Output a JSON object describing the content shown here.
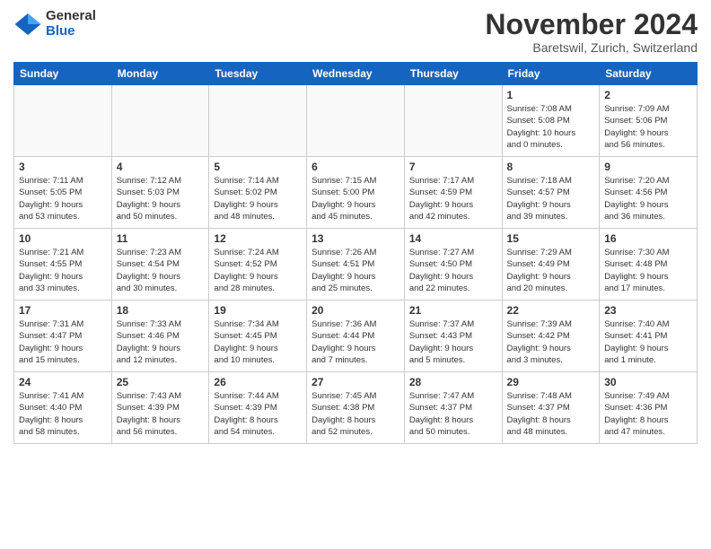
{
  "header": {
    "logo": {
      "general": "General",
      "blue": "Blue"
    },
    "title": "November 2024",
    "location": "Baretswil, Zurich, Switzerland"
  },
  "weekdays": [
    "Sunday",
    "Monday",
    "Tuesday",
    "Wednesday",
    "Thursday",
    "Friday",
    "Saturday"
  ],
  "weeks": [
    [
      {
        "day": "",
        "info": ""
      },
      {
        "day": "",
        "info": ""
      },
      {
        "day": "",
        "info": ""
      },
      {
        "day": "",
        "info": ""
      },
      {
        "day": "",
        "info": ""
      },
      {
        "day": "1",
        "info": "Sunrise: 7:08 AM\nSunset: 5:08 PM\nDaylight: 10 hours\nand 0 minutes."
      },
      {
        "day": "2",
        "info": "Sunrise: 7:09 AM\nSunset: 5:06 PM\nDaylight: 9 hours\nand 56 minutes."
      }
    ],
    [
      {
        "day": "3",
        "info": "Sunrise: 7:11 AM\nSunset: 5:05 PM\nDaylight: 9 hours\nand 53 minutes."
      },
      {
        "day": "4",
        "info": "Sunrise: 7:12 AM\nSunset: 5:03 PM\nDaylight: 9 hours\nand 50 minutes."
      },
      {
        "day": "5",
        "info": "Sunrise: 7:14 AM\nSunset: 5:02 PM\nDaylight: 9 hours\nand 48 minutes."
      },
      {
        "day": "6",
        "info": "Sunrise: 7:15 AM\nSunset: 5:00 PM\nDaylight: 9 hours\nand 45 minutes."
      },
      {
        "day": "7",
        "info": "Sunrise: 7:17 AM\nSunset: 4:59 PM\nDaylight: 9 hours\nand 42 minutes."
      },
      {
        "day": "8",
        "info": "Sunrise: 7:18 AM\nSunset: 4:57 PM\nDaylight: 9 hours\nand 39 minutes."
      },
      {
        "day": "9",
        "info": "Sunrise: 7:20 AM\nSunset: 4:56 PM\nDaylight: 9 hours\nand 36 minutes."
      }
    ],
    [
      {
        "day": "10",
        "info": "Sunrise: 7:21 AM\nSunset: 4:55 PM\nDaylight: 9 hours\nand 33 minutes."
      },
      {
        "day": "11",
        "info": "Sunrise: 7:23 AM\nSunset: 4:54 PM\nDaylight: 9 hours\nand 30 minutes."
      },
      {
        "day": "12",
        "info": "Sunrise: 7:24 AM\nSunset: 4:52 PM\nDaylight: 9 hours\nand 28 minutes."
      },
      {
        "day": "13",
        "info": "Sunrise: 7:26 AM\nSunset: 4:51 PM\nDaylight: 9 hours\nand 25 minutes."
      },
      {
        "day": "14",
        "info": "Sunrise: 7:27 AM\nSunset: 4:50 PM\nDaylight: 9 hours\nand 22 minutes."
      },
      {
        "day": "15",
        "info": "Sunrise: 7:29 AM\nSunset: 4:49 PM\nDaylight: 9 hours\nand 20 minutes."
      },
      {
        "day": "16",
        "info": "Sunrise: 7:30 AM\nSunset: 4:48 PM\nDaylight: 9 hours\nand 17 minutes."
      }
    ],
    [
      {
        "day": "17",
        "info": "Sunrise: 7:31 AM\nSunset: 4:47 PM\nDaylight: 9 hours\nand 15 minutes."
      },
      {
        "day": "18",
        "info": "Sunrise: 7:33 AM\nSunset: 4:46 PM\nDaylight: 9 hours\nand 12 minutes."
      },
      {
        "day": "19",
        "info": "Sunrise: 7:34 AM\nSunset: 4:45 PM\nDaylight: 9 hours\nand 10 minutes."
      },
      {
        "day": "20",
        "info": "Sunrise: 7:36 AM\nSunset: 4:44 PM\nDaylight: 9 hours\nand 7 minutes."
      },
      {
        "day": "21",
        "info": "Sunrise: 7:37 AM\nSunset: 4:43 PM\nDaylight: 9 hours\nand 5 minutes."
      },
      {
        "day": "22",
        "info": "Sunrise: 7:39 AM\nSunset: 4:42 PM\nDaylight: 9 hours\nand 3 minutes."
      },
      {
        "day": "23",
        "info": "Sunrise: 7:40 AM\nSunset: 4:41 PM\nDaylight: 9 hours\nand 1 minute."
      }
    ],
    [
      {
        "day": "24",
        "info": "Sunrise: 7:41 AM\nSunset: 4:40 PM\nDaylight: 8 hours\nand 58 minutes."
      },
      {
        "day": "25",
        "info": "Sunrise: 7:43 AM\nSunset: 4:39 PM\nDaylight: 8 hours\nand 56 minutes."
      },
      {
        "day": "26",
        "info": "Sunrise: 7:44 AM\nSunset: 4:39 PM\nDaylight: 8 hours\nand 54 minutes."
      },
      {
        "day": "27",
        "info": "Sunrise: 7:45 AM\nSunset: 4:38 PM\nDaylight: 8 hours\nand 52 minutes."
      },
      {
        "day": "28",
        "info": "Sunrise: 7:47 AM\nSunset: 4:37 PM\nDaylight: 8 hours\nand 50 minutes."
      },
      {
        "day": "29",
        "info": "Sunrise: 7:48 AM\nSunset: 4:37 PM\nDaylight: 8 hours\nand 48 minutes."
      },
      {
        "day": "30",
        "info": "Sunrise: 7:49 AM\nSunset: 4:36 PM\nDaylight: 8 hours\nand 47 minutes."
      }
    ]
  ]
}
